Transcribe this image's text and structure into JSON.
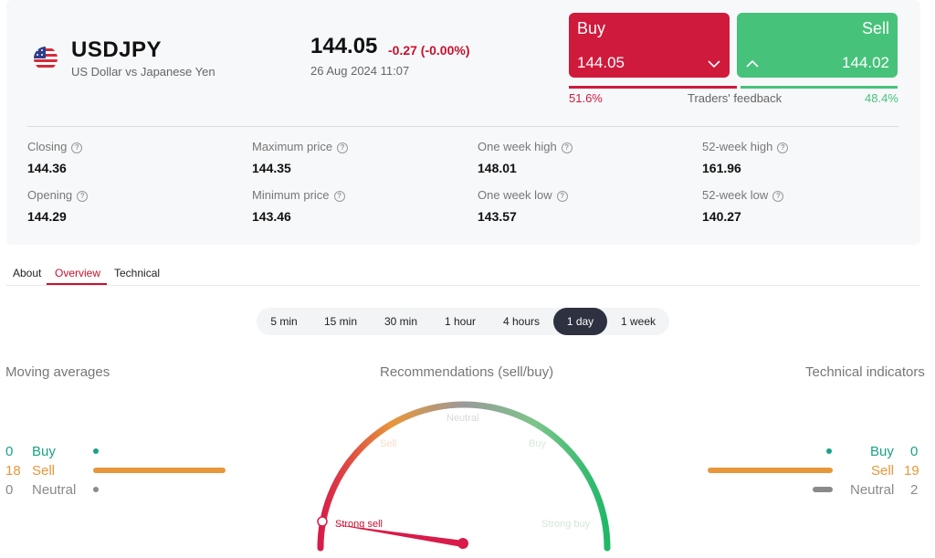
{
  "header": {
    "ticker": "USDJPY",
    "subtitle": "US Dollar vs Japanese Yen",
    "price": "144.05",
    "change": "-0.27 (-0.00%)",
    "datetime": "26 Aug 2024 11:07",
    "flag_icon": "us-flag-icon"
  },
  "trade": {
    "buy_label": "Buy",
    "buy_price": "144.05",
    "sell_label": "Sell",
    "sell_price": "144.02",
    "feedback_title": "Traders' feedback",
    "buy_pct": "51.6%",
    "sell_pct": "48.4%",
    "buy_share": 0.516,
    "sell_share": 0.484
  },
  "stats": [
    {
      "label": "Closing",
      "value": "144.36"
    },
    {
      "label": "Maximum price",
      "value": "144.35"
    },
    {
      "label": "One week high",
      "value": "148.01"
    },
    {
      "label": "52-week high",
      "value": "161.96"
    },
    {
      "label": "Opening",
      "value": "144.29"
    },
    {
      "label": "Minimum price",
      "value": "143.46"
    },
    {
      "label": "One week low",
      "value": "143.57"
    },
    {
      "label": "52-week low",
      "value": "140.27"
    }
  ],
  "tabs": [
    "About",
    "Overview",
    "Technical"
  ],
  "active_tab": "Overview",
  "periods": [
    "5 min",
    "15 min",
    "30 min",
    "1 hour",
    "4 hours",
    "1 day",
    "1 week"
  ],
  "active_period": "1 day",
  "moving_averages": {
    "title": "Moving averages",
    "buy_label": "Buy",
    "buy_count": "0",
    "sell_label": "Sell",
    "sell_count": "18",
    "neutral_label": "Neutral",
    "neutral_count": "0"
  },
  "recommendations": {
    "title": "Recommendations (sell/buy)",
    "labels": {
      "strong_sell": "Strong sell",
      "sell": "Sell",
      "neutral": "Neutral",
      "buy": "Buy",
      "strong_buy": "Strong buy"
    },
    "current": "Strong sell"
  },
  "technical_indicators": {
    "title": "Technical indicators",
    "buy_label": "Buy",
    "buy_count": "0",
    "sell_label": "Sell",
    "sell_count": "19",
    "neutral_label": "Neutral",
    "neutral_count": "2"
  },
  "colors": {
    "buy": "#cf1a3c",
    "sell": "#46c27a",
    "accent": "#c8102e",
    "teal": "#1aa187",
    "orange": "#e8963a",
    "gray": "#8a8a8a"
  }
}
